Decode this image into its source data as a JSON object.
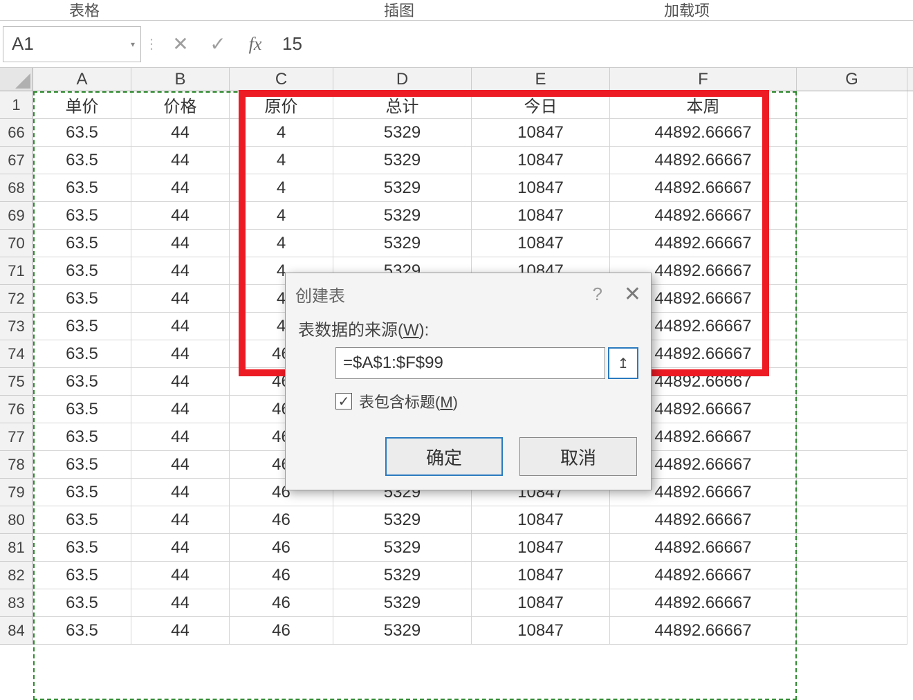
{
  "ribbon": {
    "group_tables": "表格",
    "group_illustrations": "插图",
    "group_addins": "加载项"
  },
  "formula_bar": {
    "name_box": "A1",
    "cancel": "✕",
    "confirm": "✓",
    "fx": "fx",
    "value": "15"
  },
  "columns": [
    "A",
    "B",
    "C",
    "D",
    "E",
    "F",
    "G"
  ],
  "headers_row": {
    "row_num": "1",
    "A": "单价",
    "B": "价格",
    "C": "原价",
    "D": "总计",
    "E": "今日",
    "F": "本周"
  },
  "row_numbers": [
    "66",
    "67",
    "68",
    "69",
    "70",
    "71",
    "72",
    "73",
    "74",
    "75",
    "76",
    "77",
    "78",
    "79",
    "80",
    "81",
    "82",
    "83",
    "84"
  ],
  "row_template": {
    "A": "63.5",
    "B": "44",
    "C": "46",
    "D": "5329",
    "E": "10847",
    "F": "44892.66667"
  },
  "partial_c": "4",
  "dialog": {
    "title": "创建表",
    "help": "?",
    "close": "✕",
    "source_label_pre": "表数据的来源(",
    "source_label_u": "W",
    "source_label_post": "):",
    "range": "=$A$1:$F$99",
    "picker_icon": "↥",
    "checkbox_check": "✓",
    "has_headers_pre": "表包含标题(",
    "has_headers_u": "M",
    "has_headers_post": ")",
    "ok": "确定",
    "cancel": "取消"
  }
}
